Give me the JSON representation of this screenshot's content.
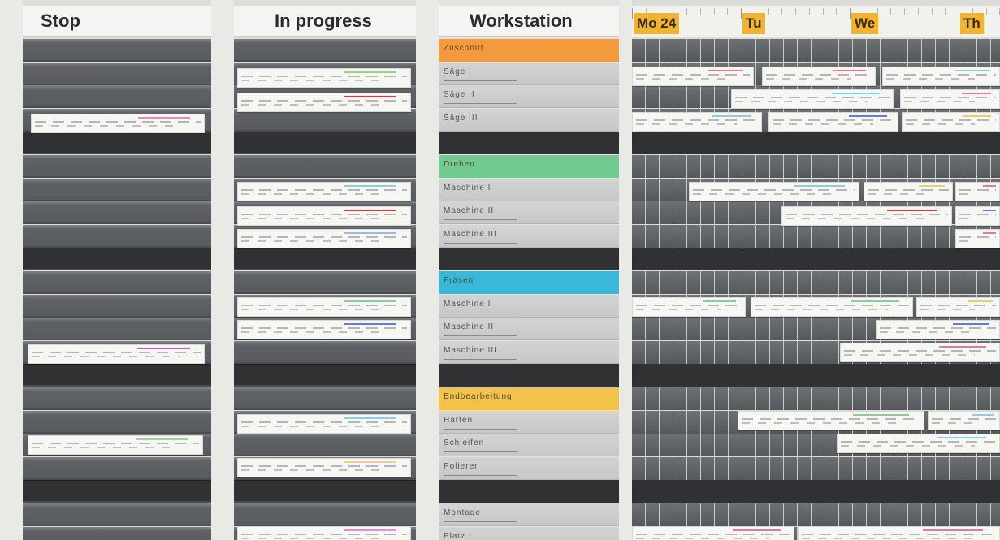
{
  "columns": {
    "stop": {
      "title": "Stop"
    },
    "in_progress": {
      "title": "In progress"
    },
    "workstation": {
      "title": "Workstation"
    }
  },
  "timeline": {
    "days": [
      "Mo 24",
      "Tu",
      "We",
      "Th"
    ]
  },
  "workstations": [
    {
      "label": "Zuschnitt",
      "kind": "category",
      "color": "#f39a3c"
    },
    {
      "label": "Säge I",
      "kind": "machine"
    },
    {
      "label": "Säge II",
      "kind": "machine"
    },
    {
      "label": "Säge III",
      "kind": "machine"
    },
    {
      "label": "",
      "kind": "divider"
    },
    {
      "label": "Drehen",
      "kind": "category",
      "color": "#6fcb8f"
    },
    {
      "label": "Maschine I",
      "kind": "machine"
    },
    {
      "label": "Maschine II",
      "kind": "machine"
    },
    {
      "label": "Maschine III",
      "kind": "machine"
    },
    {
      "label": "",
      "kind": "divider"
    },
    {
      "label": "Fräsen",
      "kind": "category",
      "color": "#38b9d8"
    },
    {
      "label": "Maschine I",
      "kind": "machine"
    },
    {
      "label": "Maschine II",
      "kind": "machine"
    },
    {
      "label": "Maschine III",
      "kind": "machine"
    },
    {
      "label": "",
      "kind": "divider"
    },
    {
      "label": "Endbearbeitung",
      "kind": "category",
      "color": "#f2c24a"
    },
    {
      "label": "Härten",
      "kind": "machine"
    },
    {
      "label": "Schleifen",
      "kind": "machine"
    },
    {
      "label": "Polieren",
      "kind": "machine"
    },
    {
      "label": "",
      "kind": "divider"
    },
    {
      "label": "Montage",
      "kind": "machine"
    },
    {
      "label": "Platz I",
      "kind": "machine"
    }
  ],
  "colors": {
    "board_frame": "#e9e9e6",
    "slot_grey": "#5f6265",
    "slot_dark": "#2f3133",
    "day_marker": "#f1b431",
    "card": "#f6f6f3"
  }
}
